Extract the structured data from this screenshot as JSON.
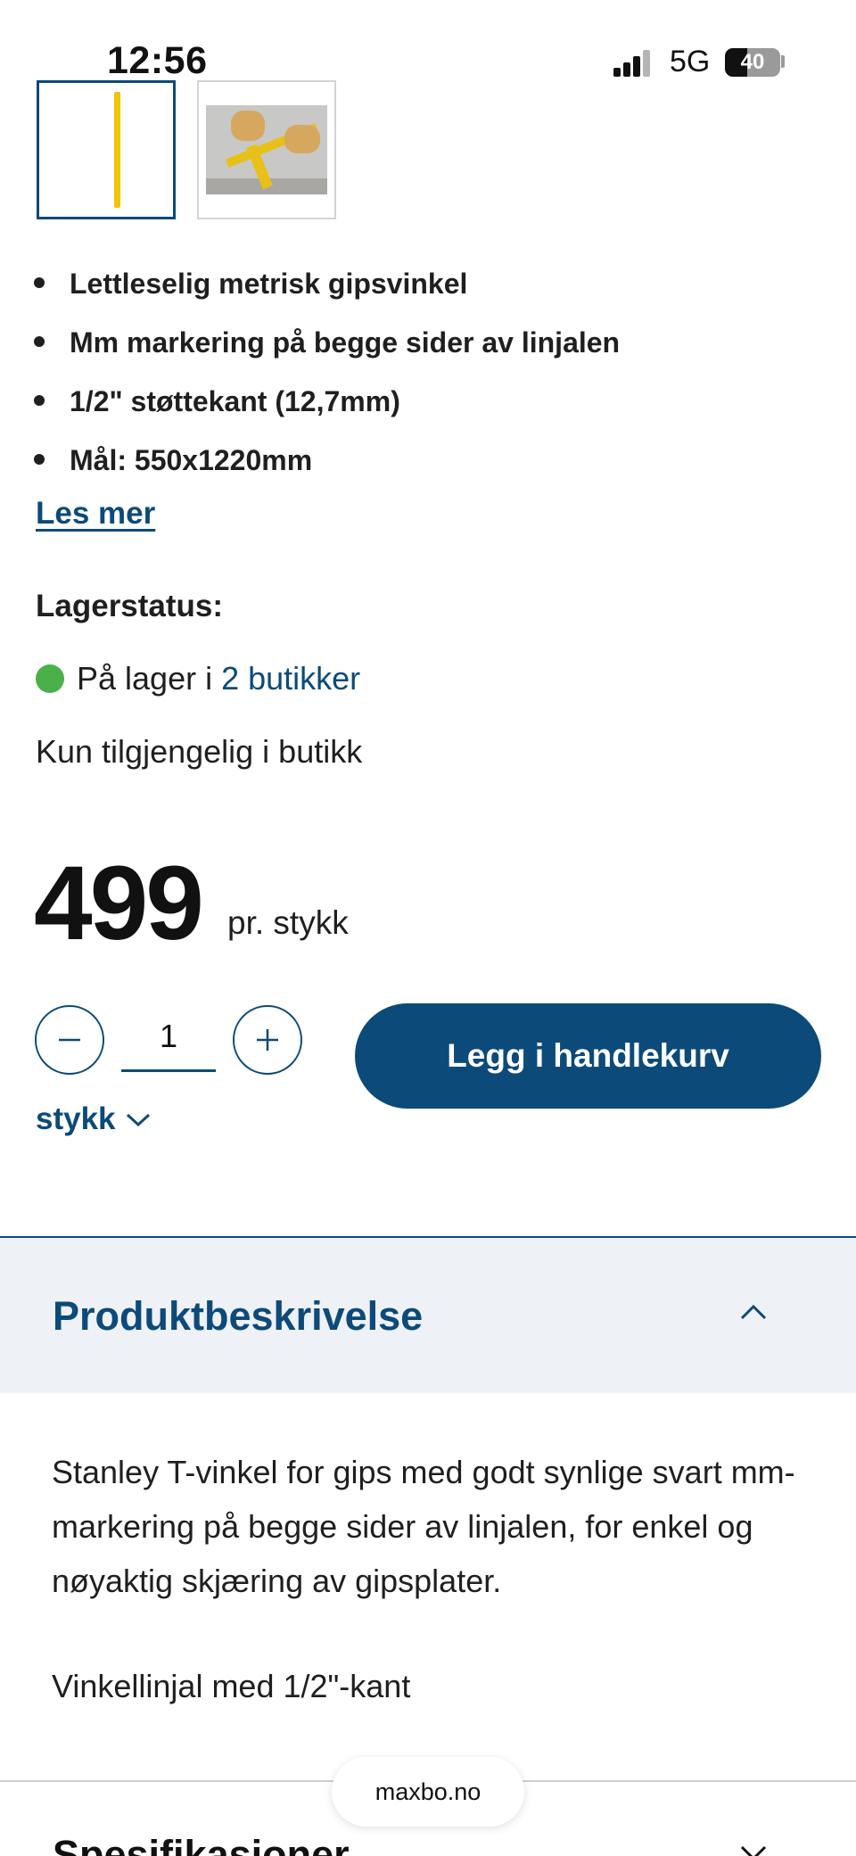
{
  "status_bar": {
    "time": "12:56",
    "network": "5G",
    "battery": "40"
  },
  "gallery": {
    "thumbnails": [
      {
        "label": "product-image",
        "selected": true
      },
      {
        "label": "usage-image",
        "selected": false
      }
    ]
  },
  "features": [
    "Lettleselig metrisk gipsvinkel",
    "Mm markering på begge sider av linjalen",
    "1/2\" støttekant (12,7mm)",
    "Mål: 550x1220mm"
  ],
  "read_more": "Les mer",
  "stock": {
    "title": "Lagerstatus:",
    "status_text": "På lager i",
    "stores_link": "2 butikker",
    "status_color": "#49b04a",
    "availability": "Kun tilgjengelig i butikk"
  },
  "price": {
    "amount": "499",
    "unit": "pr. stykk"
  },
  "quantity": {
    "value": "1",
    "minus": "−",
    "plus": "+",
    "unit": "stykk"
  },
  "add_to_cart": "Legg i handlekurv",
  "accordion": {
    "title": "Produktbeskrivelse",
    "expanded": true
  },
  "description": {
    "paragraph": "Stanley T-vinkel for gips med godt synlige svart mm-markering på begge sider av linjalen, for enkel og nøyaktig skjæring av gipsplater.",
    "line2": "Vinkellinjal med 1/2\"-kant"
  },
  "next_section": "Spesifikasjoner",
  "browser": {
    "url": "maxbo.no"
  },
  "colors": {
    "brand": "#0c4a79",
    "accordion_bg": "#eef1f5"
  }
}
